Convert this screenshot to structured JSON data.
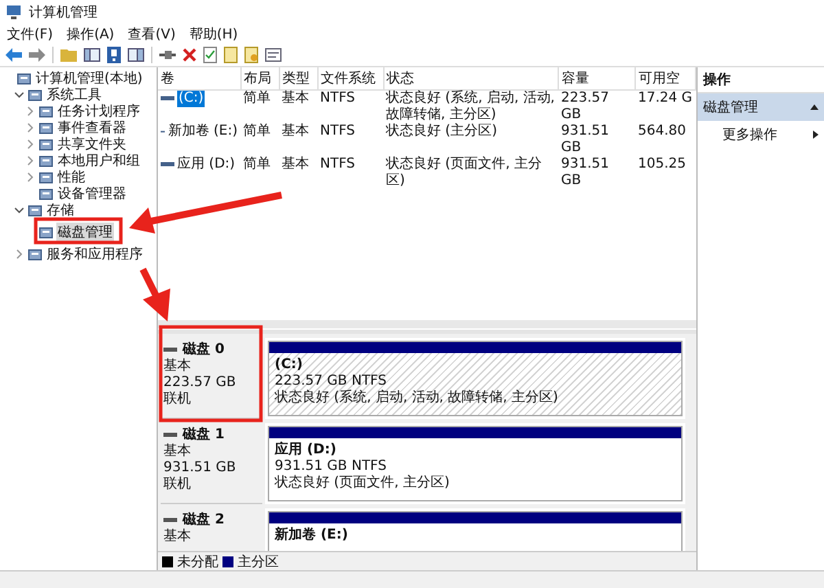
{
  "window": {
    "title": "计算机管理"
  },
  "menu": [
    "文件(F)",
    "操作(A)",
    "查看(V)",
    "帮助(H)"
  ],
  "tree": [
    {
      "label": "计算机管理(本地)",
      "selected": false,
      "children": [
        {
          "label": "系统工具",
          "selected": false,
          "expanded": true,
          "children": [
            {
              "label": "任务计划程序",
              "selected": false,
              "expanded": false
            },
            {
              "label": "事件查看器",
              "selected": false,
              "expanded": false
            },
            {
              "label": "共享文件夹",
              "selected": false,
              "expanded": false
            },
            {
              "label": "本地用户和组",
              "selected": false,
              "expanded": false
            },
            {
              "label": "性能",
              "selected": false,
              "expanded": false
            },
            {
              "label": "设备管理器",
              "selected": false
            }
          ]
        },
        {
          "label": "存储",
          "selected": false,
          "expanded": true,
          "children": [
            {
              "label": "磁盘管理",
              "selected": true
            }
          ]
        },
        {
          "label": "服务和应用程序",
          "selected": false,
          "expanded": false
        }
      ]
    }
  ],
  "table": {
    "columns": [
      "卷",
      "布局",
      "类型",
      "文件系统",
      "状态",
      "容量",
      "可用空"
    ],
    "rows": [
      {
        "cells": [
          "(C:)",
          "简单",
          "基本",
          "NTFS",
          "状态良好 (系统, 启动, 活动, 故障转储, 主分区)",
          "223.57 GB",
          "17.24 G"
        ],
        "selected": true
      },
      {
        "cells": [
          "新加卷 (E:)",
          "简单",
          "基本",
          "NTFS",
          "状态良好 (主分区)",
          "931.51 GB",
          "564.80"
        ],
        "selected": false
      },
      {
        "cells": [
          "应用 (D:)",
          "简单",
          "基本",
          "NTFS",
          "状态良好 (页面文件, 主分区)",
          "931.51 GB",
          "105.25"
        ],
        "selected": false
      }
    ]
  },
  "disks": [
    {
      "name": "磁盘 0",
      "type": "基本",
      "size": "223.57 GB",
      "state": "联机",
      "partitions": [
        {
          "label": "(C:)",
          "size": "223.57 GB NTFS",
          "status": "状态良好 (系统, 启动, 活动, 故障转储, 主分区)",
          "selected": true
        }
      ]
    },
    {
      "name": "磁盘 1",
      "type": "基本",
      "size": "931.51 GB",
      "state": "联机",
      "partitions": [
        {
          "label": "应用  (D:)",
          "size": "931.51 GB NTFS",
          "status": "状态良好 (页面文件, 主分区)",
          "selected": false
        }
      ]
    },
    {
      "name": "磁盘 2",
      "type": "基本",
      "partitions": [
        {
          "label": "新加卷  (E:)",
          "selected": false
        }
      ]
    }
  ],
  "legend": [
    {
      "label": "未分配",
      "color": "#000000"
    },
    {
      "label": "主分区",
      "color": "#000080"
    }
  ],
  "actions": {
    "title": "操作",
    "section": "磁盘管理",
    "items": [
      "更多操作"
    ]
  }
}
